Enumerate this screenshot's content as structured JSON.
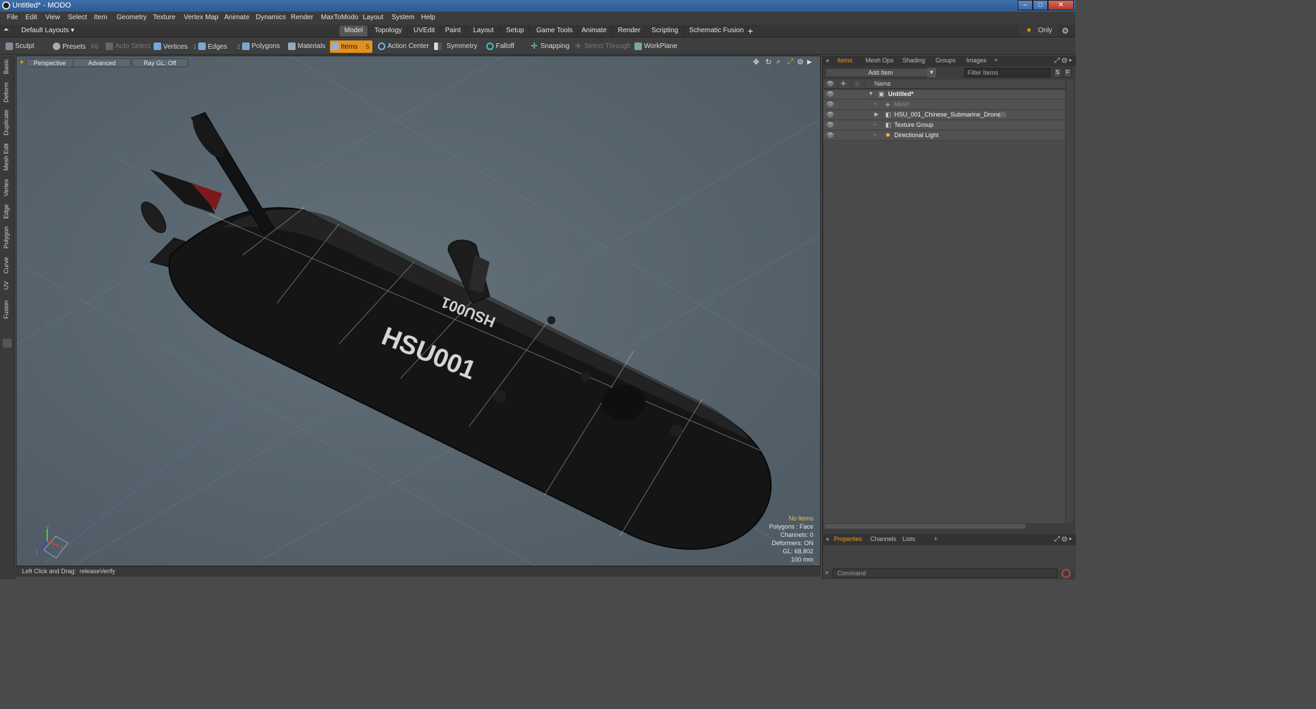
{
  "window": {
    "title": "Untitled* - MODO",
    "min": "–",
    "max": "□",
    "close": "✕"
  },
  "menu": [
    "File",
    "Edit",
    "View",
    "Select",
    "Item",
    "Geometry",
    "Texture",
    "Vertex Map",
    "Animate",
    "Dynamics",
    "Render",
    "MaxToModo",
    "Layout",
    "System",
    "Help"
  ],
  "layouts": {
    "label": "Default Layouts ▾",
    "tabs": [
      "Model",
      "Topology",
      "UVEdit",
      "Paint",
      "Layout",
      "Setup",
      "Game Tools",
      "Animate",
      "Render",
      "Scripting",
      "Schematic Fusion"
    ],
    "active": "Model",
    "add": "+",
    "only": "Only",
    "star": "★",
    "gear": "⚙"
  },
  "toolbar": {
    "sculpt": "Sculpt",
    "presets": "Presets",
    "presets_key": "F6",
    "auto_select": "Auto Select",
    "vertices": "Vertices",
    "vertices_n": "1",
    "edges": "Edges",
    "edges_n": "2",
    "polygons": "Polygons",
    "materials": "Materials",
    "items": "Items",
    "items_n": "5",
    "action_center": "Action Center",
    "symmetry": "Symmetry",
    "falloff": "Falloff",
    "snapping": "Snapping",
    "select_through": "Select Through",
    "workplane": "WorkPlane"
  },
  "lefttabs": [
    "Basic",
    "Deform",
    "Duplicate",
    "Mesh Edit",
    "Vertex",
    "Edge",
    "Polygon",
    "Curve",
    "UV",
    "Fusion"
  ],
  "viewport": {
    "view": "Perspective",
    "shading": "Advanced",
    "raygl": "Ray GL: Off",
    "hull_label": "HSU001",
    "stats": {
      "items": "No Items",
      "polygons": "Polygons : Face",
      "channels": "Channels: 0",
      "deformers": "Deformers: ON",
      "gl": "GL: 68,802",
      "units": "100 mm"
    },
    "axes": {
      "x": "x",
      "y": "y",
      "z": "z"
    }
  },
  "status": {
    "hint_label": "Left Click and Drag:",
    "hint_value": "releaseVerify"
  },
  "rightpanel": {
    "tabs": [
      "Items",
      "Mesh Ops",
      "Shading",
      "Groups",
      "Images"
    ],
    "add_tab": "+",
    "add_item": "Add Item",
    "filter": "Filter Items",
    "s": "S",
    "f": "F",
    "col_name": "Name",
    "tree": [
      {
        "label": "Untitled*",
        "count": ""
      },
      {
        "label": "Mesh",
        "count": ""
      },
      {
        "label": "HSU_001_Chinese_Submarine_Drone",
        "count": "(3)"
      },
      {
        "label": "Texture Group",
        "count": ""
      },
      {
        "label": "Directional Light",
        "count": ""
      }
    ],
    "bottom_tabs": [
      "Properties",
      "Channels",
      "Lists"
    ],
    "command_placeholder": "Command",
    "prompt": ">"
  },
  "colors": {
    "accent": "#e6901c",
    "viewport_bg": "#5b6770",
    "hull": "#161616",
    "hull_text": "#d8d8d8"
  }
}
